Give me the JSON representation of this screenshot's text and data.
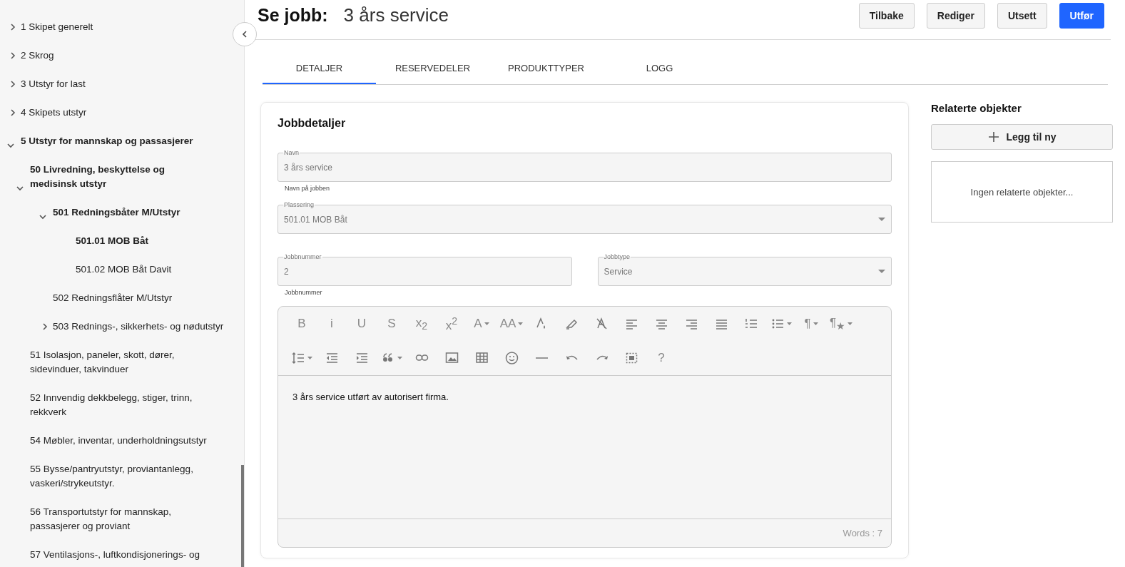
{
  "sidebar": {
    "tree": [
      {
        "label": "1 Skipet generelt",
        "kind": "group",
        "expanded": false
      },
      {
        "label": "2 Skrog",
        "kind": "group",
        "expanded": false
      },
      {
        "label": "3 Utstyr for last",
        "kind": "group",
        "expanded": false
      },
      {
        "label": "4 Skipets utstyr",
        "kind": "group",
        "expanded": false
      },
      {
        "label": "5 Utstyr for mannskap og passasjerer",
        "kind": "group",
        "expanded": true,
        "children": [
          {
            "label": "50 Livredning, beskyttelse og medisinsk utstyr",
            "kind": "group",
            "expanded": true,
            "children": [
              {
                "label": "501 Redningsbåter M/Utstyr",
                "kind": "group",
                "expanded": true,
                "children": [
                  {
                    "label": "501.01 MOB Båt",
                    "kind": "leaf",
                    "selected": true
                  },
                  {
                    "label": "501.02 MOB Båt Davit",
                    "kind": "leaf",
                    "selected": false
                  }
                ]
              },
              {
                "label": "502 Redningsflåter M/Utstyr",
                "kind": "leaf",
                "selected": false
              },
              {
                "label": "503 Rednings-, sikkerhets- og nødutstyr",
                "kind": "group",
                "expanded": false
              }
            ]
          },
          {
            "label": "51 Isolasjon, paneler, skott, dører, sidevinduer, takvinduer",
            "kind": "leaf",
            "selected": false
          },
          {
            "label": "52 Innvendig dekkbelegg, stiger, trinn, rekkverk",
            "kind": "leaf",
            "selected": false
          },
          {
            "label": "54 Møbler, inventar, underholdningsutstyr",
            "kind": "leaf",
            "selected": false
          },
          {
            "label": "55 Bysse/pantryutstyr, proviantanlegg, vaskeri/strykeutstyr.",
            "kind": "leaf",
            "selected": false
          },
          {
            "label": "56 Transportutstyr for mannskap, passasjerer og proviant",
            "kind": "leaf",
            "selected": false
          },
          {
            "label": "57 Ventilasjons-, luftkondisjonerings- og",
            "kind": "leaf",
            "selected": false
          }
        ]
      }
    ]
  },
  "header": {
    "title": "Se jobb:",
    "subtitle": "3 års service",
    "buttons": [
      {
        "label": "Tilbake",
        "kind": "secondary"
      },
      {
        "label": "Rediger",
        "kind": "secondary"
      },
      {
        "label": "Utsett",
        "kind": "secondary"
      },
      {
        "label": "Utfør",
        "kind": "primary"
      }
    ]
  },
  "tabs": [
    {
      "label": "DETALJER",
      "selected": true
    },
    {
      "label": "RESERVEDELER",
      "selected": false
    },
    {
      "label": "PRODUKTTYPER",
      "selected": false
    },
    {
      "label": "LOGG",
      "selected": false
    }
  ],
  "details": {
    "title": "Jobbdetaljer",
    "field_rows": [
      [
        {
          "label": "Navn",
          "value": "3 års service",
          "helper": "Navn på jobben",
          "kind": "text"
        }
      ],
      [
        {
          "label": "Plassering",
          "value": "501.01 MOB Båt",
          "kind": "select"
        }
      ],
      [
        {
          "label": "Jobbnummer",
          "value": "2",
          "helper": "Jobbnummer",
          "kind": "text"
        },
        {
          "label": "Jobbtype",
          "value": "Service",
          "kind": "select"
        }
      ]
    ],
    "editor": {
      "toolbar": [
        [
          {
            "kind": "glyph",
            "text": "B",
            "caret": false
          },
          {
            "kind": "glyph",
            "text": "i",
            "caret": false
          },
          {
            "kind": "glyph",
            "text": "U",
            "caret": false
          },
          {
            "kind": "glyph",
            "text": "S",
            "caret": false
          },
          {
            "kind": "glyph",
            "text": "x$_{2}$",
            "caret": false
          },
          {
            "kind": "glyph",
            "text": "x$^{2}$",
            "caret": false
          },
          {
            "kind": "glyph",
            "text": "A",
            "caret": true
          },
          {
            "kind": "glyph",
            "text": "AA",
            "caret": true
          },
          {
            "kind": "textcolor",
            "caret": false
          },
          {
            "kind": "highlight",
            "caret": false
          },
          {
            "kind": "clearformat",
            "caret": false
          },
          {
            "kind": "alignleft",
            "caret": false
          },
          {
            "kind": "aligncenter",
            "caret": false
          },
          {
            "kind": "alignright",
            "caret": false
          },
          {
            "kind": "justify",
            "caret": false
          },
          {
            "kind": "orderedlist",
            "caret": false
          },
          {
            "kind": "bulletlist",
            "caret": true
          },
          {
            "kind": "glyph",
            "text": "¶",
            "caret": true
          },
          {
            "kind": "glyph",
            "text": "¶$_{★}$",
            "caret": true
          }
        ],
        [
          {
            "kind": "lineheight",
            "caret": true
          },
          {
            "kind": "outdent",
            "caret": false
          },
          {
            "kind": "indent",
            "caret": false
          },
          {
            "kind": "quote",
            "caret": true
          },
          {
            "kind": "link",
            "caret": false
          },
          {
            "kind": "image",
            "caret": false
          },
          {
            "kind": "table",
            "caret": false
          },
          {
            "kind": "emoji",
            "caret": false
          },
          {
            "kind": "rule",
            "caret": false
          },
          {
            "kind": "undo",
            "caret": false
          },
          {
            "kind": "redo",
            "caret": false
          },
          {
            "kind": "selectall",
            "caret": false
          },
          {
            "kind": "glyph",
            "text": "?",
            "caret": false
          }
        ]
      ],
      "content": "3 års service utført av autorisert firma.",
      "word_count": "Words : 7"
    }
  },
  "related": {
    "title": "Relaterte objekter",
    "add_label": "Legg til ny",
    "empty_text": "Ingen relaterte objekter..."
  }
}
